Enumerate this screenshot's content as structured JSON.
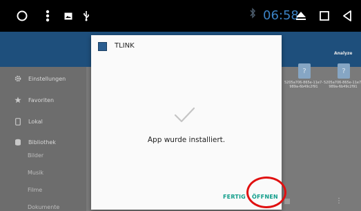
{
  "status_bar": {
    "time": "06:58",
    "icons": [
      "circle-home-icon",
      "overflow-menu-icon",
      "image-notification-icon",
      "usb-icon",
      "bluetooth-icon",
      "eject-icon",
      "square-recents-icon",
      "triangle-back-icon"
    ]
  },
  "background_app": {
    "header_action": "Analyze",
    "sidebar": {
      "items": [
        {
          "label": "Einstellungen",
          "icon": "gear-icon"
        },
        {
          "label": "Favoriten",
          "icon": "star-icon"
        },
        {
          "label": "Lokal",
          "icon": "phone-icon"
        },
        {
          "label": "Bibliothek",
          "icon": "library-icon"
        }
      ],
      "sub_items": [
        "Bilder",
        "Musik",
        "Filme",
        "Dokumente"
      ]
    },
    "files": [
      {
        "name": "5205a706-865e-11e7-989a-6b49c2f91"
      },
      {
        "name": "5205a706-865e-11e7-989a-6b49c2f91"
      }
    ]
  },
  "dialog": {
    "app_name": "TLINK",
    "message": "App wurde installiert.",
    "done_label": "FERTIG",
    "open_label": "ÖFFNEN"
  },
  "colors": {
    "accent": "#0f9d8a",
    "header": "#1e4f7c",
    "highlight": "#e01010"
  }
}
